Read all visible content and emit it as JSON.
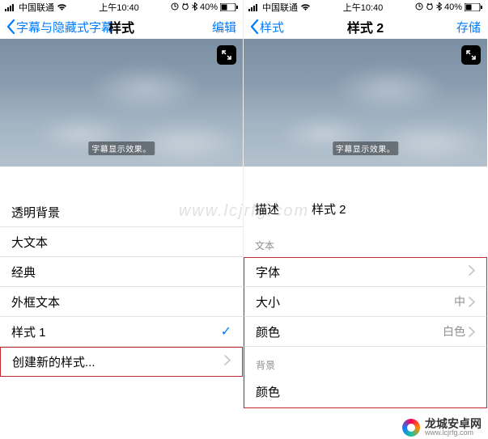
{
  "status": {
    "carrier": "中国联通",
    "time": "上午10:40",
    "battery_pct": "40%"
  },
  "left": {
    "nav": {
      "back": "字幕与隐藏式字幕",
      "title": "样式",
      "action": "编辑"
    },
    "preview": {
      "caption": "字幕显示效果。"
    },
    "styles": [
      {
        "label": "透明背景",
        "selected": false
      },
      {
        "label": "大文本",
        "selected": false
      },
      {
        "label": "经典",
        "selected": false
      },
      {
        "label": "外框文本",
        "selected": false
      },
      {
        "label": "样式 1",
        "selected": true
      }
    ],
    "create_new": "创建新的样式..."
  },
  "right": {
    "nav": {
      "back": "样式",
      "title": "样式 2",
      "action": "存储"
    },
    "preview": {
      "caption": "字幕显示效果。"
    },
    "description": {
      "key": "描述",
      "value": "样式 2"
    },
    "text_section": {
      "header": "文本",
      "items": [
        {
          "label": "字体",
          "value": ""
        },
        {
          "label": "大小",
          "value": "中"
        },
        {
          "label": "颜色",
          "value": "白色"
        }
      ]
    },
    "bg_section": {
      "header": "背景",
      "items": [
        {
          "label": "颜色",
          "value": ""
        }
      ]
    }
  },
  "watermark": {
    "title": "龙城安卓网",
    "url": "www.lcjrfg.com"
  },
  "overlay_url": "www.lcjrfg.com"
}
